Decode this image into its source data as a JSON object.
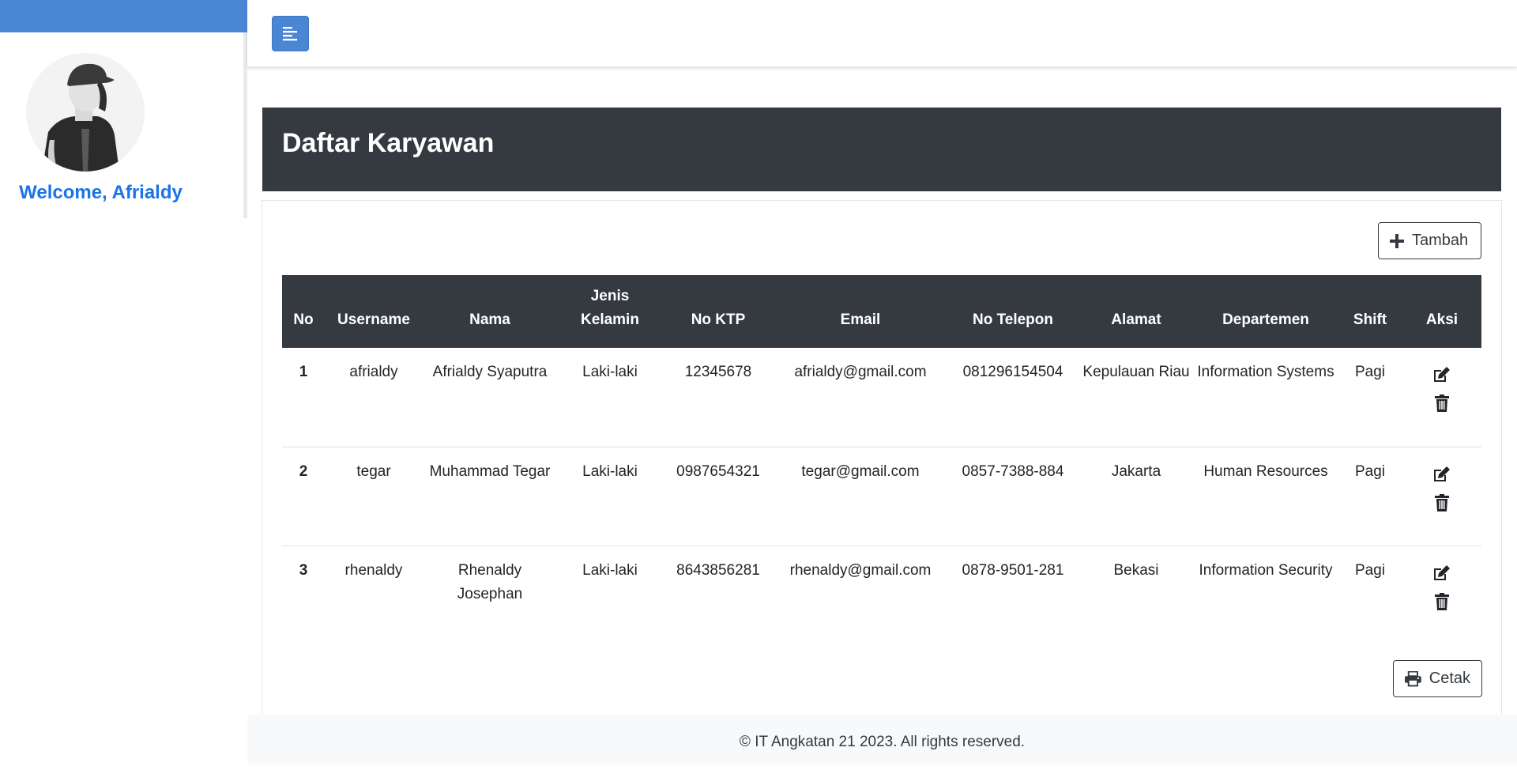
{
  "sidebar": {
    "welcome_text": "Welcome, Afrialdy",
    "brand_color": "#4a86d4",
    "avatar_icon": "user-photo"
  },
  "topbar": {
    "toggle_icon": "align-left-icon"
  },
  "page": {
    "title": "Daftar Karyawan"
  },
  "actions": {
    "add_label": "Tambah",
    "print_label": "Cetak",
    "edit_icon": "edit-icon",
    "delete_icon": "trash-icon"
  },
  "table": {
    "headers": [
      "No",
      "Username",
      "Nama",
      "Jenis Kelamin",
      "No KTP",
      "Email",
      "No Telepon",
      "Alamat",
      "Departemen",
      "Shift",
      "Aksi"
    ],
    "rows": [
      {
        "no": "1",
        "username": "afrialdy",
        "nama": "Afrialdy Syaputra",
        "jenis_kelamin": "Laki-laki",
        "no_ktp": "12345678",
        "email": "afrialdy@gmail.com",
        "no_telepon": "081296154504",
        "alamat": "Kepulauan Riau",
        "departemen": "Information Systems",
        "shift": "Pagi"
      },
      {
        "no": "2",
        "username": "tegar",
        "nama": "Muhammad Tegar",
        "jenis_kelamin": "Laki-laki",
        "no_ktp": "0987654321",
        "email": "tegar@gmail.com",
        "no_telepon": "0857-7388-884",
        "alamat": "Jakarta",
        "departemen": "Human Resources",
        "shift": "Pagi"
      },
      {
        "no": "3",
        "username": "rhenaldy",
        "nama": "Rhenaldy Josephan",
        "jenis_kelamin": "Laki-laki",
        "no_ktp": "8643856281",
        "email": "rhenaldy@gmail.com",
        "no_telepon": "0878-9501-281",
        "alamat": "Bekasi",
        "departemen": "Information Security",
        "shift": "Pagi"
      }
    ]
  },
  "footer": {
    "text": "© IT Angkatan 21 2023. All rights reserved."
  }
}
